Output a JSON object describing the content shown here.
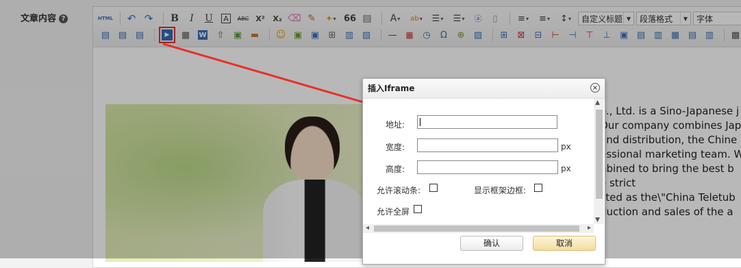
{
  "field_label": "文章内容",
  "help_icon": "?",
  "toolbar": {
    "html_label": "HTML",
    "bold": "B",
    "italic": "I",
    "underline": "U",
    "superscript": "X²",
    "subscript": "X₂",
    "quote": "66",
    "font_color": "A",
    "heading_select": "自定义标题",
    "paragraph_select": "段落格式",
    "font_select": "字体",
    "omega": "Ω",
    "highlighted_button": "insert-iframe-button"
  },
  "background_text": [
    "o., Ltd. is a Sino-Japanese j",
    "Our company combines Jap",
    "and distribution, the Chine",
    "essional marketing team. W",
    "nbined to bring the best b",
    "e strict",
    "cted as the\\\"China Teletub",
    "duction and sales of the a"
  ],
  "dialog": {
    "title": "插入Iframe",
    "close": "×",
    "address_label": "地址:",
    "width_label": "宽度:",
    "height_label": "高度:",
    "px_unit": "px",
    "scroll_label": "允许滚动条:",
    "border_label": "显示框架边框:",
    "fullscreen_label": "允许全屏",
    "ok_label": "确认",
    "cancel_label": "取消"
  },
  "colors": {
    "highlight": "#e0312b",
    "arrow": "#e8302a",
    "cancel_bg": "#f3dca0"
  }
}
